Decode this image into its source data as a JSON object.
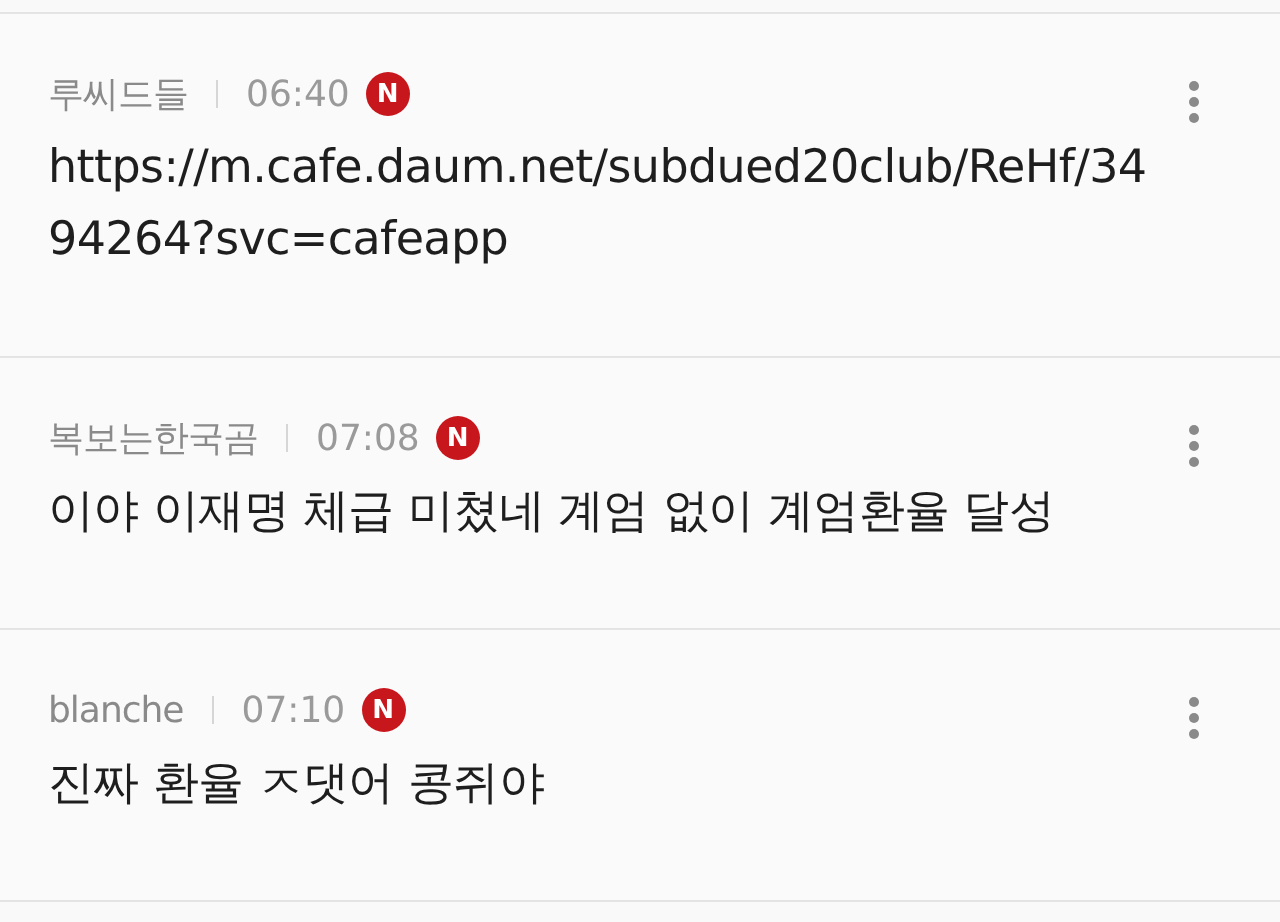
{
  "comments": [
    {
      "author": "루씨드들",
      "time": "06:40",
      "badge": "N",
      "text": "https://m.cafe.daum.net/subdued20club/ReHf/3494264?svc=cafeapp"
    },
    {
      "author": "복보는한국곰",
      "time": "07:08",
      "badge": "N",
      "text": "이야 이재명 체급 미쳤네 계엄 없이 계엄환율 달성"
    },
    {
      "author": "blanche",
      "time": "07:10",
      "badge": "N",
      "text": "진짜 환율 ㅈ댓어 콩쥐야"
    }
  ]
}
